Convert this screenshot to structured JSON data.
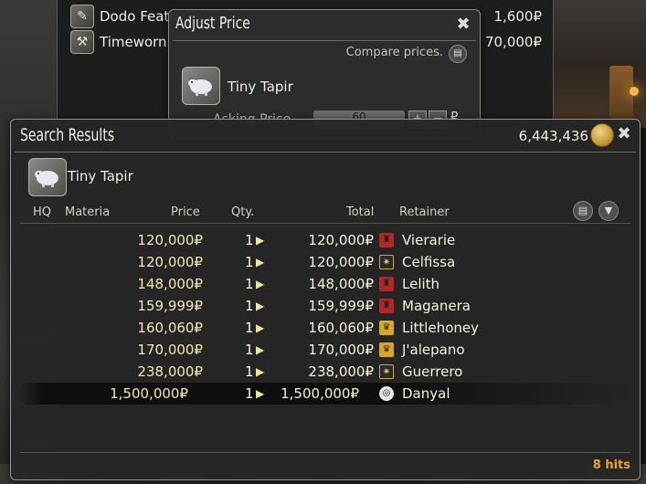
{
  "top_list": {
    "rows": [
      {
        "icon": "feather-icon",
        "name": "Dodo Feath",
        "price": "1,600₽"
      },
      {
        "icon": "tool-icon",
        "name": "Timeworn",
        "price": "70,000₽"
      }
    ]
  },
  "adjust_price": {
    "title": "Adjust Price",
    "compare_label": "Compare prices.",
    "item_name": "Tiny Tapir",
    "asking_label": "Asking Price",
    "asking_value": "60",
    "currency": "₽"
  },
  "search_results": {
    "title": "Search Results",
    "gil": "6,443,436",
    "item_name": "Tiny Tapir",
    "columns": {
      "hq": "HQ",
      "materia": "Materia",
      "price": "Price",
      "qty": "Qty.",
      "total": "Total",
      "retainer": "Retainer"
    },
    "listings": [
      {
        "price": "120,000₽",
        "qty": "1",
        "total": "120,000₽",
        "retainer": "Vierarie",
        "city": "red"
      },
      {
        "price": "120,000₽",
        "qty": "1",
        "total": "120,000₽",
        "retainer": "Celfissa",
        "city": "dark"
      },
      {
        "price": "148,000₽",
        "qty": "1",
        "total": "148,000₽",
        "retainer": "Lelith",
        "city": "red"
      },
      {
        "price": "159,999₽",
        "qty": "1",
        "total": "159,999₽",
        "retainer": "Maganera",
        "city": "red"
      },
      {
        "price": "160,060₽",
        "qty": "1",
        "total": "160,060₽",
        "retainer": "Littlehoney",
        "city": "gold"
      },
      {
        "price": "170,000₽",
        "qty": "1",
        "total": "170,000₽",
        "retainer": "J'alepano",
        "city": "gold"
      },
      {
        "price": "238,000₽",
        "qty": "1",
        "total": "238,000₽",
        "retainer": "Guerrero",
        "city": "dark"
      },
      {
        "price": "1,500,000₽",
        "qty": "1",
        "total": "1,500,000₽",
        "retainer": "Danyal",
        "city": "white"
      }
    ],
    "hits": "8 hits"
  },
  "colors": {
    "price_text": "#f3e7b0",
    "hits": "#f0a030"
  }
}
